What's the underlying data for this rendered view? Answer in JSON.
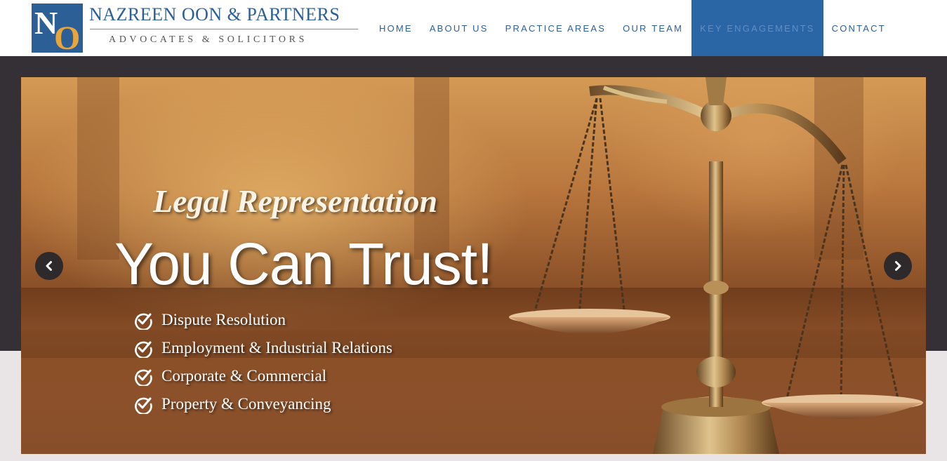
{
  "logo": {
    "mark_n": "N",
    "mark_o": "O",
    "name": "NAZREEN OON & PARTNERS",
    "tagline": "ADVOCATES & SOLICITORS",
    "colors": {
      "blue": "#2d5f97",
      "gold": "#e8a53b"
    }
  },
  "nav": {
    "items": [
      {
        "label": "HOME"
      },
      {
        "label": "ABOUT US"
      },
      {
        "label": "PRACTICE AREAS"
      },
      {
        "label": "OUR TEAM"
      },
      {
        "label": "KEY ENGAGEMENTS",
        "active": true
      },
      {
        "label": "CONTACT"
      }
    ],
    "active_color": "#2a66a6"
  },
  "slider": {
    "script_line": "Legal Representation",
    "headline": "You Can Trust!",
    "services": [
      {
        "label": "Dispute Resolution",
        "icon": "check-circle-icon"
      },
      {
        "label": "Employment & Industrial Relations",
        "icon": "check-circle-icon"
      },
      {
        "label": "Corporate & Commercial",
        "icon": "check-circle-icon"
      },
      {
        "label": "Property & Conveyancing",
        "icon": "check-circle-icon"
      }
    ],
    "prev_icon": "chevron-left-icon",
    "next_icon": "chevron-right-icon"
  }
}
